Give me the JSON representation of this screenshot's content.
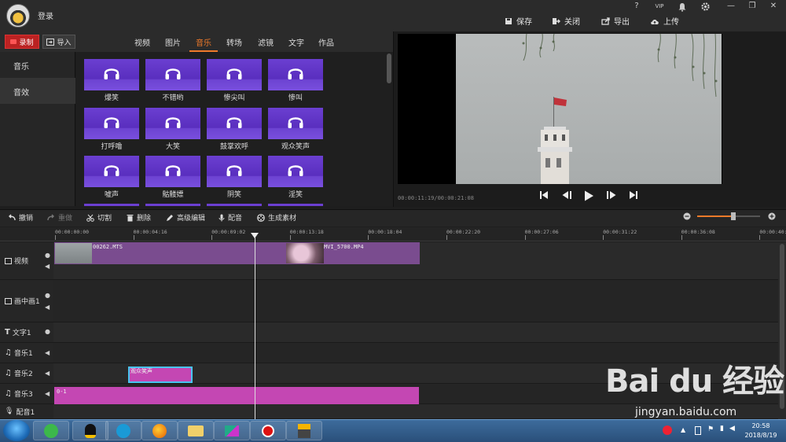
{
  "header": {
    "login_label": "登录",
    "actions": {
      "save": "保存",
      "close": "关闭",
      "export": "导出",
      "upload": "上传"
    },
    "window_icons": [
      "help-icon",
      "vip-icon",
      "bell-icon",
      "gear-icon",
      "minimize-icon",
      "maximize-icon",
      "close-icon"
    ],
    "window_glyphs": {
      "help": "?",
      "vip": "VIP",
      "minimize": "—",
      "maximize": "❐",
      "close": "✕"
    }
  },
  "library": {
    "record_label": "录制",
    "import_label": "导入",
    "tabs": [
      "视频",
      "图片",
      "音乐",
      "转场",
      "滤镜",
      "文字",
      "作品"
    ],
    "active_tab": "音乐",
    "categories": [
      "音乐",
      "音效"
    ],
    "active_category": "音效",
    "items": [
      "爆笑",
      "不错哟",
      "惨尖叫",
      "惨叫",
      "打呼噜",
      "大笑",
      "鼓掌欢呼",
      "观众笑声",
      "嘘声",
      "骷髅嫖",
      "阴笑",
      "淫笑"
    ]
  },
  "preview": {
    "timecode": "00:00:11:19/00:00:21:08"
  },
  "toolbar": {
    "undo": "撤销",
    "redo": "重做",
    "cut": "切割",
    "delete": "删除",
    "advanced_edit": "高级编辑",
    "dub": "配音",
    "generate": "生成素材"
  },
  "ruler": {
    "ticks": [
      "00:00:00:00",
      "00:00:04:16",
      "00:00:09:02",
      "00:00:13:18",
      "00:00:18:04",
      "00:00:22:20",
      "00:00:27:06",
      "00:00:31:22",
      "00:00:36:08",
      "00:00:40:"
    ]
  },
  "tracks": {
    "video": {
      "label": "视频",
      "clips": [
        "00262.MTS",
        "MVI_5700.MP4"
      ]
    },
    "pip": {
      "label": "画中画1"
    },
    "text": {
      "label": "文字1"
    },
    "music1": {
      "label": "音乐1"
    },
    "music2": {
      "label": "音乐2",
      "clip": "观众笑声"
    },
    "music3": {
      "label": "音乐3",
      "clip": "0-1"
    },
    "dub": {
      "label": "配音1"
    }
  },
  "taskbar": {
    "time": "20:58",
    "date": "2018/8/19"
  },
  "watermark": {
    "logo": "Bai du 经验",
    "url": "jingyan.baidu.com"
  },
  "colors": {
    "accent": "#f07a2a",
    "tile_purple": "#6b3fd1",
    "video_clip": "#7a4c8f",
    "music_clip": "#c447b3",
    "record_red": "#b22222"
  }
}
